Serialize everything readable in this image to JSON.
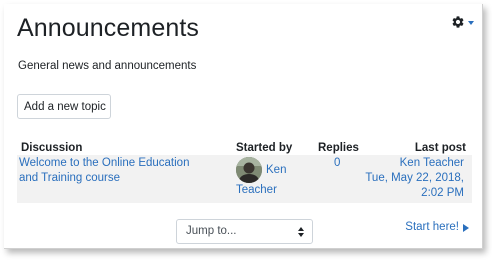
{
  "page": {
    "title": "Announcements",
    "intro": "General news and announcements"
  },
  "actions": {
    "add_topic_label": "Add a new topic"
  },
  "settings_menu": {
    "icon": "gear-icon",
    "caret": "caret-down-icon",
    "color": "#2a6fbd"
  },
  "table": {
    "headers": {
      "discussion": "Discussion",
      "started_by": "Started by",
      "replies": "Replies",
      "last_post": "Last post"
    },
    "rows": [
      {
        "discussion": "Welcome to the Online Education and Training course",
        "author_first": "Ken",
        "author_last": "Teacher",
        "replies": "0",
        "last_post_author": "Ken Teacher",
        "last_post_date": "Tue, May 22, 2018,",
        "last_post_time": "2:02 PM"
      }
    ]
  },
  "navigation": {
    "jump_to": "Jump to...",
    "next_label": "Start here!"
  },
  "colors": {
    "link": "#2a6fbd",
    "row_background": "#f2f2f2"
  }
}
